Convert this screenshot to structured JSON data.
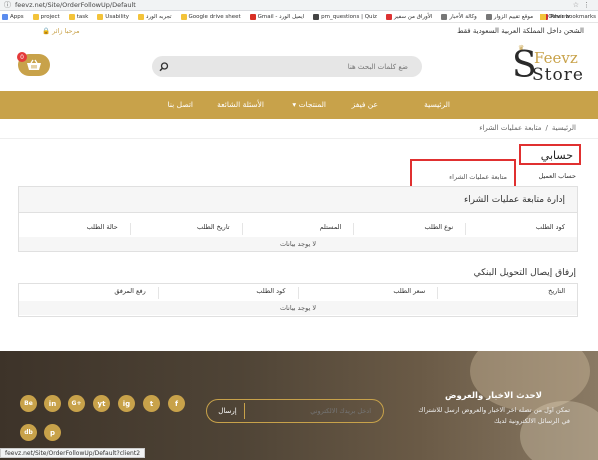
{
  "browser": {
    "url": "feevz.net/Site/OrderFollowUp/Default",
    "bookmarks": [
      "Apps",
      "project",
      "task",
      "Usability",
      "تجربه الورد",
      "Google drive sheet",
      "Gmail - ايميل الورد",
      "pm_questions | Quiz",
      "الأوراق من سفير",
      "وكالة الأخبار",
      "موقع تقييم الزوار",
      "Review",
      "Other bookmarks"
    ],
    "status": "feevz.net/Site/OrderFollowUp/Default?client2"
  },
  "header": {
    "ship_notice": "الشحن داخل المملكة العربية السعودية فقط",
    "top_links": "مرحبا زائر 🔒",
    "logo_feevz": "Feevz",
    "logo_store": "Store",
    "search_placeholder": "ضع كلمات البحث هنا",
    "cart_count": "0"
  },
  "nav": {
    "home": "الرئيسية",
    "about": "عن فيفز",
    "products": "المنتجات",
    "faq": "الأسئلة الشائعة",
    "contact": "اتصل بنا"
  },
  "breadcrumb": {
    "home": "الرئيسية",
    "sep": "/",
    "current": "متابعة عمليات الشراء"
  },
  "account": {
    "title": "حسابي",
    "customer_account": "حساب العميل",
    "track_purchases": "متابعة عمليات الشراء"
  },
  "orders": {
    "title": "إدارة متابعة عمليات الشراء",
    "headers": [
      "كود الطلب",
      "نوع الطلب",
      "المستلم",
      "تاريخ الطلب",
      "حالة الطلب"
    ],
    "empty": "لا يوجد بيانات"
  },
  "bank": {
    "title": "إرفاق إيصال التحويل البنكي",
    "headers": [
      "التاريخ",
      "سعر الطلب",
      "كود الطلب",
      "رفع المرفق"
    ],
    "empty": "لا يوجد بيانات"
  },
  "footer": {
    "title": "لاحدث الاخبار والعروض",
    "desc": "تمكن اول من تصله اخر الاخبار والعروض ارسل للاشتراك في الرسائل الالكترونية لديك",
    "email_placeholder": "ادخل بريدك الالكتروني",
    "send": "إرسال",
    "social": [
      "f",
      "t",
      "ig",
      "yt",
      "G+",
      "in",
      "Be",
      "db",
      "p"
    ]
  }
}
